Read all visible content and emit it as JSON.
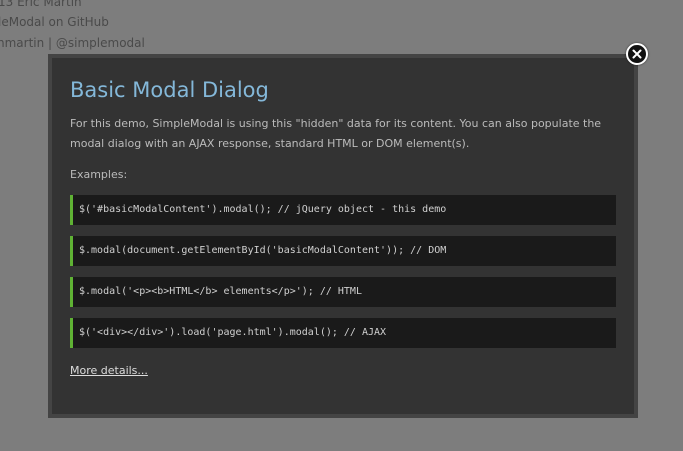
{
  "background": {
    "lines": [
      "13 Eric Martin",
      "leModal on GitHub",
      "nmartin | @simplemodal"
    ]
  },
  "modal": {
    "title": "Basic Modal Dialog",
    "description": "For this demo, SimpleModal is using this \"hidden\" data for its content. You can also populate the modal dialog with an AJAX response, standard HTML or DOM element(s).",
    "examples_label": "Examples:",
    "code_examples": [
      "$('#basicModalContent').modal(); // jQuery object - this demo",
      "$.modal(document.getElementById('basicModalContent')); // DOM",
      "$.modal('<p><b>HTML</b> elements</p>'); // HTML",
      "$('<div></div>').load('page.html').modal(); // AJAX"
    ],
    "more_link": "More details..."
  },
  "colors": {
    "overlay": "#7d7d7d",
    "modal_bg": "#333333",
    "title": "#84b8d9",
    "code_bg": "#1a1a1a",
    "code_accent": "#5fb234"
  },
  "icons": {
    "close": "close-icon"
  }
}
